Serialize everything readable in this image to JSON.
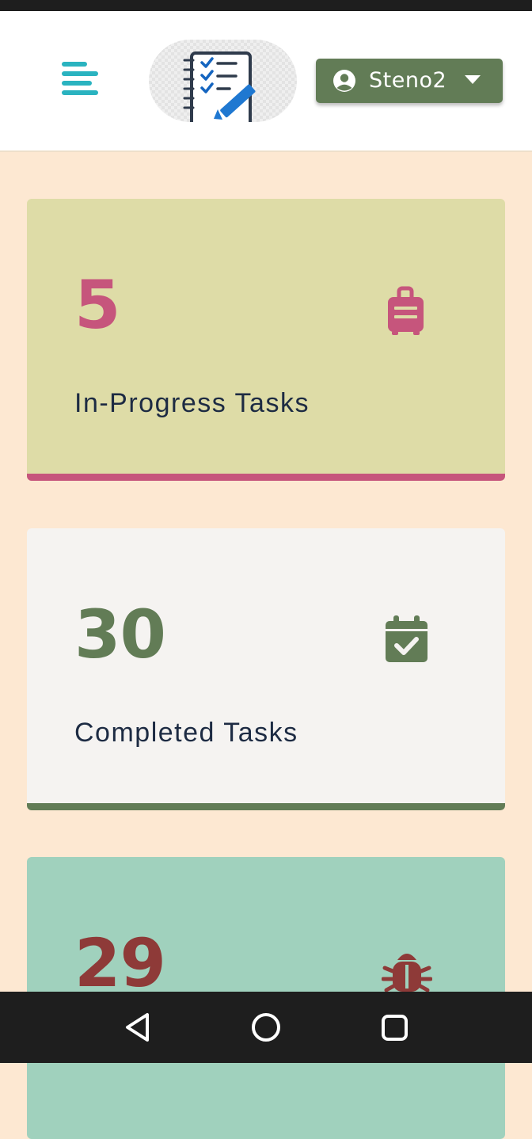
{
  "header": {
    "menu_icon": "hamburger-menu-icon",
    "logo_icon": "checklist-notebook-pencil-icon",
    "user": {
      "name": "Steno2",
      "icon": "user-circle-icon",
      "caret": "caret-down-icon"
    }
  },
  "cards": [
    {
      "count": "5",
      "label": "In-Progress Tasks",
      "icon": "suitcase-icon",
      "color": "#c6557c",
      "background": "#dedca7"
    },
    {
      "count": "30",
      "label": "Completed Tasks",
      "icon": "calendar-check-icon",
      "color": "#627c56",
      "background": "#f5f3f1"
    },
    {
      "count": "29",
      "label": "",
      "icon": "bug-icon",
      "color": "#8e3a38",
      "background": "#a0d1bd"
    }
  ],
  "nav": {
    "back": "back-triangle-icon",
    "home": "home-circle-icon",
    "recents": "recents-square-icon"
  },
  "colors": {
    "page_background": "#fde8d2",
    "accent_menu": "#2ab3c0",
    "user_button": "#627c56"
  }
}
